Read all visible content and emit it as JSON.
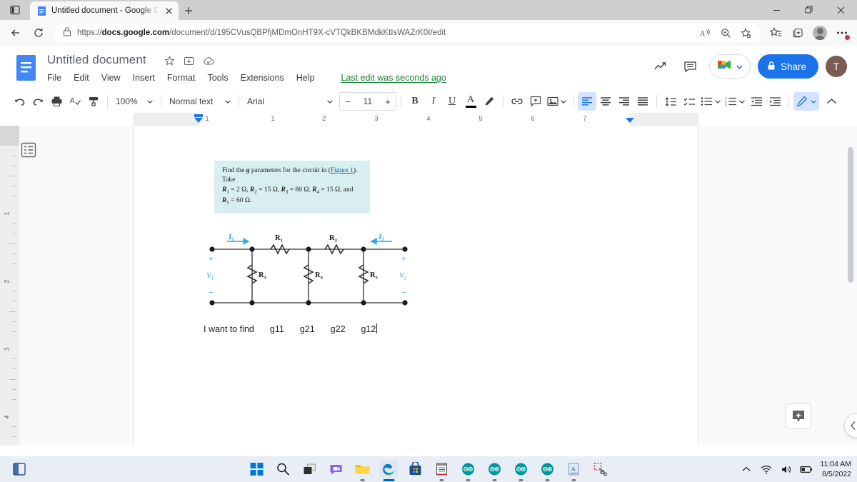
{
  "browser": {
    "tab": {
      "title": "Untitled document - Google Doc",
      "favicon": "google-docs-icon"
    },
    "new_tab_label": "+",
    "url": {
      "scheme": "https://",
      "domain": "docs.google.com",
      "path": "/document/d/195CVusQBPfjMDmOnHT9X-cVTQkBKBMdkKtIsWAZrK0I/edit",
      "full": "https://docs.google.com/document/d/195CVusQBPfjMDmOnHT9X-cVTQkBKBMdkKtIsWAZrK0I/edit"
    },
    "window_controls": {
      "minimize": "minimize-icon",
      "restore": "restore-icon",
      "close": "close-icon"
    },
    "toolbar_icons": [
      "read-aloud-icon",
      "zoom-icon",
      "add-favorite-icon",
      "favorites-icon",
      "collections-icon",
      "profile-icon",
      "settings-more-icon"
    ],
    "nav_icons": [
      "back-icon",
      "refresh-icon",
      "lock-icon"
    ]
  },
  "docs": {
    "title": "Untitled document",
    "title_icons": [
      "star-icon",
      "move-to-folder-icon",
      "cloud-saved-icon"
    ],
    "menu": [
      "File",
      "Edit",
      "View",
      "Insert",
      "Format",
      "Tools",
      "Extensions",
      "Help"
    ],
    "last_edit": "Last edit was seconds ago",
    "header_right": {
      "activity_icon": "trending-activity-icon",
      "comment_icon": "comment-history-icon",
      "meet_label": "google-meet-icon",
      "share_label": "Share",
      "avatar_initial": "T"
    },
    "toolbar": {
      "undo": "undo-icon",
      "redo": "redo-icon",
      "print": "print-icon",
      "spellcheck": "spellcheck-icon",
      "paint_format": "paint-format-icon",
      "zoom_value": "100%",
      "style_value": "Normal text",
      "font_value": "Arial",
      "font_size_value": "11",
      "font_size_minus": "−",
      "font_size_plus": "+",
      "bold": "B",
      "italic": "I",
      "underline": "U",
      "text_color": "A",
      "highlight": "highlight-pen-icon",
      "link": "link-icon",
      "comment": "add-comment-icon",
      "image": "insert-image-icon",
      "align_left": "align-left-icon",
      "align_center": "align-center-icon",
      "align_right": "align-right-icon",
      "align_justify": "align-justify-icon",
      "line_spacing": "line-spacing-icon",
      "checklist": "checklist-icon",
      "bullet_list": "bulleted-list-icon",
      "numbered_list": "numbered-list-icon",
      "indent_less": "decrease-indent-icon",
      "indent_more": "increase-indent-icon",
      "editing_mode": "editing-pencil-icon",
      "collapse": "collapse-toolbar-icon"
    },
    "ruler": {
      "horizontal_numbers": [
        "1",
        "1",
        "2",
        "3",
        "4",
        "5",
        "6",
        "7"
      ],
      "vertical_numbers": [
        "1",
        "2",
        "3",
        "4"
      ]
    },
    "outline_button": "document-outline-icon",
    "explore_button": "explore-icon",
    "collapse_panel_button": "collapse-panel-icon"
  },
  "document": {
    "problem": {
      "line1_pre": "Find the ",
      "line1_g": "g",
      "line1_mid": " parameters for the circuit in (",
      "line1_link": "Figure 1",
      "line1_post": "). Take",
      "values": [
        {
          "symbol": "R",
          "sub": "1",
          "eq": "= 2 Ω,"
        },
        {
          "symbol": "R",
          "sub": "2",
          "eq": "= 15 Ω,"
        },
        {
          "symbol": "R",
          "sub": "3",
          "eq": "= 80 Ω,"
        },
        {
          "symbol": "R",
          "sub": "4",
          "eq": "= 15 Ω, and"
        },
        {
          "symbol": "R",
          "sub": "5",
          "eq": "= 60 Ω."
        }
      ],
      "background_color": "#d9eef1"
    },
    "circuit": {
      "labels": {
        "v1": "V",
        "v1_sub": "1",
        "v2": "V",
        "v2_sub": "2",
        "i1": "I",
        "i1_sub": "1",
        "i2": "I",
        "i2_sub": "2",
        "r1": "R",
        "r1_sub": "1",
        "r2": "R",
        "r2_sub": "2",
        "r3": "R",
        "r3_sub": "3",
        "r4": "R",
        "r4_sub": "4",
        "r5": "R",
        "r5_sub": "5",
        "plus": "+",
        "minus": "−"
      },
      "accent_color": "#29abe2"
    },
    "answer_line": {
      "prompt": "I want to find",
      "terms": [
        "g11",
        "g21",
        "g22",
        "g12"
      ]
    }
  },
  "taskbar": {
    "items": [
      {
        "name": "start-button",
        "label": "Start"
      },
      {
        "name": "search-button",
        "label": "Search"
      },
      {
        "name": "task-view-button",
        "label": "Task View"
      },
      {
        "name": "chat-button",
        "label": "Chat"
      },
      {
        "name": "file-explorer-button",
        "label": "File Explorer"
      },
      {
        "name": "edge-button",
        "label": "Microsoft Edge"
      },
      {
        "name": "store-button",
        "label": "Microsoft Store"
      },
      {
        "name": "notepad-button",
        "label": "Notepad"
      },
      {
        "name": "arduino-button-1",
        "label": "Arduino IDE"
      },
      {
        "name": "arduino-button-2",
        "label": "Arduino IDE"
      },
      {
        "name": "arduino-button-3",
        "label": "Arduino IDE"
      },
      {
        "name": "arduino-button-4",
        "label": "Arduino IDE"
      },
      {
        "name": "document-app-button",
        "label": "Document"
      },
      {
        "name": "snipping-tool-button",
        "label": "Snipping Tool"
      }
    ],
    "tray": [
      "show-hidden-icons",
      "wifi-icon",
      "volume-icon",
      "battery-icon"
    ],
    "clock": {
      "time": "11:04 AM",
      "date": "8/5/2022"
    }
  }
}
